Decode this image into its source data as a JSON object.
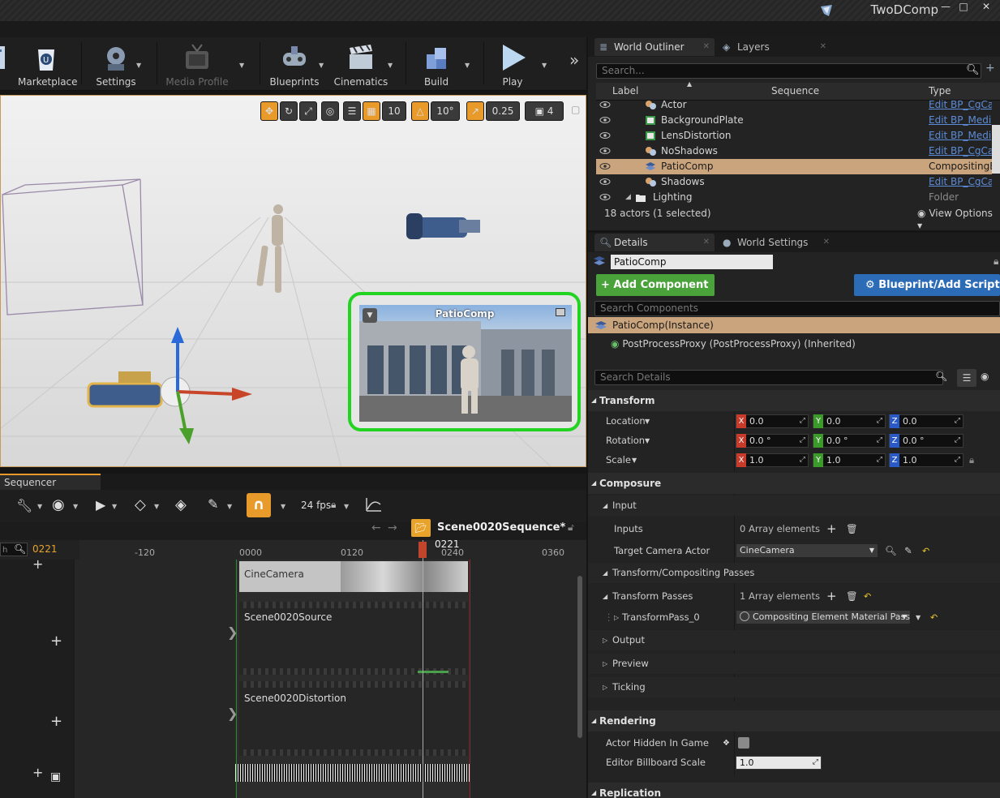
{
  "window": {
    "title": "TwoDComp"
  },
  "toolbar": {
    "items": [
      {
        "label": "nt",
        "icon": "content-icon"
      },
      {
        "label": "Marketplace",
        "icon": "marketplace-icon"
      },
      {
        "label": "Settings",
        "icon": "settings-icon"
      },
      {
        "label": "Media Profile",
        "icon": "media-profile-icon",
        "disabled": true
      },
      {
        "label": "Blueprints",
        "icon": "blueprints-icon"
      },
      {
        "label": "Cinematics",
        "icon": "cinematics-icon"
      },
      {
        "label": "Build",
        "icon": "build-icon"
      },
      {
        "label": "Play",
        "icon": "play-icon"
      }
    ],
    "overflow": "»"
  },
  "viewport": {
    "grid_snap": "10",
    "rotation_snap": "10°",
    "scale_snap": "0.25",
    "camera_speed": "4",
    "pip_title": "PatioComp"
  },
  "outliner": {
    "tabs": [
      "World Outliner",
      "Layers"
    ],
    "search_placeholder": "Search...",
    "columns": [
      "Label",
      "Sequence",
      "Type"
    ],
    "rows": [
      {
        "label": "Actor",
        "type": "Edit BP_CgCa",
        "icon": "blueprint-icon"
      },
      {
        "label": "BackgroundPlate",
        "type": "Edit BP_Medi",
        "icon": "media-plate-icon"
      },
      {
        "label": "LensDistortion",
        "type": "Edit BP_Medi",
        "icon": "media-plate-icon"
      },
      {
        "label": "NoShadows",
        "type": "Edit BP_CgCa",
        "icon": "blueprint-icon"
      },
      {
        "label": "PatioComp",
        "type": "CompositingE",
        "icon": "composite-icon",
        "selected": true
      },
      {
        "label": "Shadows",
        "type": "Edit BP_CgCa",
        "icon": "blueprint-icon"
      },
      {
        "label": "Lighting",
        "type": "Folder",
        "icon": "folder-icon"
      }
    ],
    "status": "18 actors (1 selected)",
    "view_options": "View Options"
  },
  "details": {
    "tabs": [
      "Details",
      "World Settings"
    ],
    "object_name": "PatioComp",
    "add_component": "+ Add Component",
    "blueprint_button": "Blueprint/Add Script",
    "search_components_placeholder": "Search Components",
    "instance_label": "PatioComp(Instance)",
    "component_label": "PostProcessProxy (PostProcessProxy) (Inherited)",
    "search_details_placeholder": "Search Details",
    "transform": {
      "header": "Transform",
      "location_label": "Location",
      "rotation_label": "Rotation",
      "scale_label": "Scale",
      "location": [
        "0.0",
        "0.0",
        "0.0"
      ],
      "rotation": [
        "0.0 °",
        "0.0 °",
        "0.0 °"
      ],
      "scale": [
        "1.0",
        "1.0",
        "1.0"
      ]
    },
    "composure": {
      "header": "Composure",
      "input": "Input",
      "inputs_label": "Inputs",
      "inputs_value": "0 Array elements",
      "target_camera_label": "Target Camera Actor",
      "target_camera_value": "CineCamera",
      "transform_passes_header": "Transform/Compositing Passes",
      "transform_passes_label": "Transform Passes",
      "transform_passes_value": "1 Array elements",
      "transform_pass_0_label": "TransformPass_0",
      "transform_pass_0_value": "Compositing Element Material Pass",
      "output": "Output",
      "preview": "Preview",
      "ticking": "Ticking"
    },
    "rendering": {
      "header": "Rendering",
      "hidden_label": "Actor Hidden In Game",
      "billboard_label": "Editor Billboard Scale",
      "billboard_value": "1.0"
    },
    "replication_header": "Replication"
  },
  "sequencer": {
    "tab": "Sequencer",
    "fps": "24 fps",
    "sequence_name": "Scene0020Sequence*",
    "current_frame": "0221",
    "playhead_label": "0221",
    "ticks": [
      "-120",
      "0000",
      "0120",
      "0240",
      "0360"
    ],
    "tracks": [
      {
        "name": "CineCamera"
      },
      {
        "name": "Scene0020Source"
      },
      {
        "name": "Scene0020Distortion"
      }
    ]
  }
}
